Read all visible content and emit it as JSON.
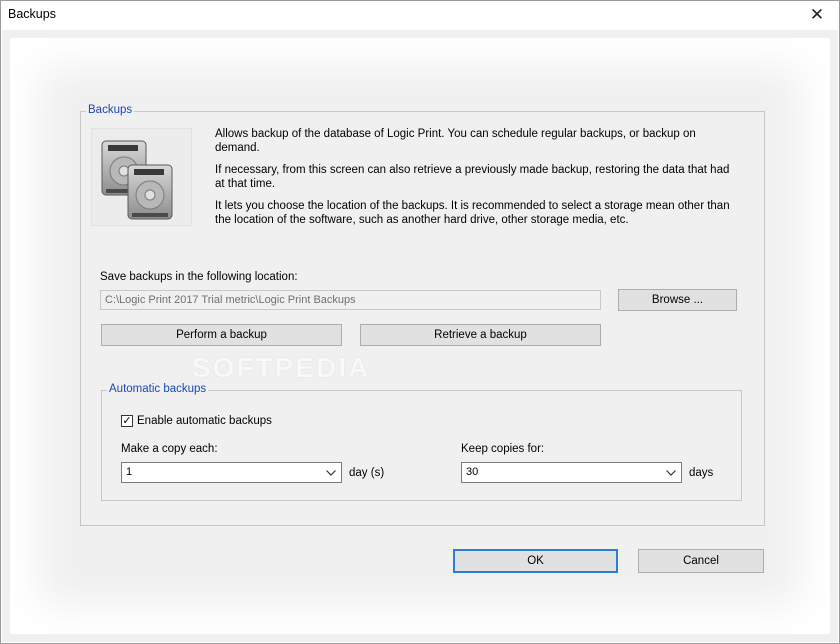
{
  "window": {
    "title": "Backups",
    "close_glyph": "✕"
  },
  "backups_group": {
    "title": "Backups",
    "icon": "hard-drives-icon",
    "paragraphs": [
      "Allows backup of the database of Logic Print. You can schedule regular backups, or backup on demand.",
      "If necessary, from this screen can also retrieve a previously made backup, restoring the data that had at that time.",
      "It lets you choose the location of the backups. It is recommended to select a storage mean other than the location of the software, such as another hard drive, other storage media, etc."
    ],
    "location_label": "Save backups in the following location:",
    "location_value": "C:\\Logic Print 2017 Trial metric\\Logic Print Backups",
    "browse_label": "Browse ...",
    "perform_label": "Perform a backup",
    "retrieve_label": "Retrieve a backup"
  },
  "auto_group": {
    "title": "Automatic backups",
    "enable_label": "Enable automatic backups",
    "enable_checked": true,
    "check_glyph": "✓",
    "copy_each_label": "Make a copy each:",
    "copy_each_value": "1",
    "copy_each_unit": "day (s)",
    "keep_label": "Keep copies for:",
    "keep_value": "30",
    "keep_unit": "days"
  },
  "footer": {
    "ok_label": "OK",
    "cancel_label": "Cancel"
  },
  "watermark": "SOFTPEDIA"
}
